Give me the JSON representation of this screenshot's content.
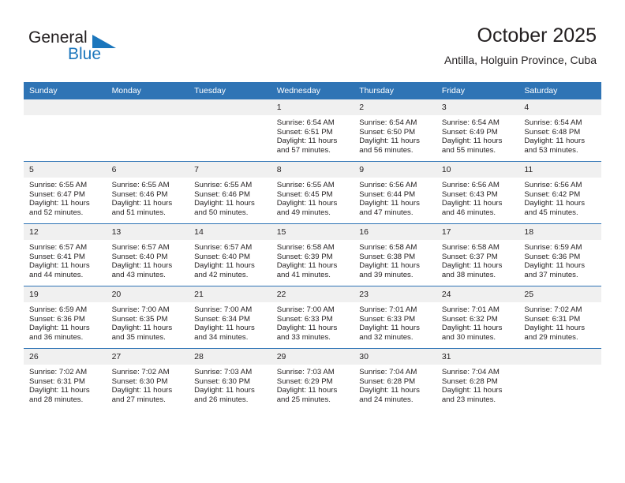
{
  "brand": {
    "word1": "General",
    "word2": "Blue",
    "triangle_color": "#1b76bc"
  },
  "header": {
    "title": "October 2025",
    "subtitle": "Antilla, Holguin Province, Cuba"
  },
  "theme": {
    "header_band": "#2f74b5",
    "daynum_band": "#f0f0f0",
    "text": "#231f20"
  },
  "labels": {
    "sunrise_prefix": "Sunrise:",
    "sunset_prefix": "Sunset:",
    "daylight_prefix": "Daylight:"
  },
  "weekdays": [
    "Sunday",
    "Monday",
    "Tuesday",
    "Wednesday",
    "Thursday",
    "Friday",
    "Saturday"
  ],
  "weeks": [
    [
      {
        "day": "",
        "sunrise": "",
        "sunset": "",
        "daylight_line1": "",
        "daylight_line2": "",
        "blank": true
      },
      {
        "day": "",
        "sunrise": "",
        "sunset": "",
        "daylight_line1": "",
        "daylight_line2": "",
        "blank": true
      },
      {
        "day": "",
        "sunrise": "",
        "sunset": "",
        "daylight_line1": "",
        "daylight_line2": "",
        "blank": true
      },
      {
        "day": "1",
        "sunrise": "Sunrise: 6:54 AM",
        "sunset": "Sunset: 6:51 PM",
        "daylight_line1": "Daylight: 11 hours",
        "daylight_line2": "and 57 minutes."
      },
      {
        "day": "2",
        "sunrise": "Sunrise: 6:54 AM",
        "sunset": "Sunset: 6:50 PM",
        "daylight_line1": "Daylight: 11 hours",
        "daylight_line2": "and 56 minutes."
      },
      {
        "day": "3",
        "sunrise": "Sunrise: 6:54 AM",
        "sunset": "Sunset: 6:49 PM",
        "daylight_line1": "Daylight: 11 hours",
        "daylight_line2": "and 55 minutes."
      },
      {
        "day": "4",
        "sunrise": "Sunrise: 6:54 AM",
        "sunset": "Sunset: 6:48 PM",
        "daylight_line1": "Daylight: 11 hours",
        "daylight_line2": "and 53 minutes."
      }
    ],
    [
      {
        "day": "5",
        "sunrise": "Sunrise: 6:55 AM",
        "sunset": "Sunset: 6:47 PM",
        "daylight_line1": "Daylight: 11 hours",
        "daylight_line2": "and 52 minutes."
      },
      {
        "day": "6",
        "sunrise": "Sunrise: 6:55 AM",
        "sunset": "Sunset: 6:46 PM",
        "daylight_line1": "Daylight: 11 hours",
        "daylight_line2": "and 51 minutes."
      },
      {
        "day": "7",
        "sunrise": "Sunrise: 6:55 AM",
        "sunset": "Sunset: 6:46 PM",
        "daylight_line1": "Daylight: 11 hours",
        "daylight_line2": "and 50 minutes."
      },
      {
        "day": "8",
        "sunrise": "Sunrise: 6:55 AM",
        "sunset": "Sunset: 6:45 PM",
        "daylight_line1": "Daylight: 11 hours",
        "daylight_line2": "and 49 minutes."
      },
      {
        "day": "9",
        "sunrise": "Sunrise: 6:56 AM",
        "sunset": "Sunset: 6:44 PM",
        "daylight_line1": "Daylight: 11 hours",
        "daylight_line2": "and 47 minutes."
      },
      {
        "day": "10",
        "sunrise": "Sunrise: 6:56 AM",
        "sunset": "Sunset: 6:43 PM",
        "daylight_line1": "Daylight: 11 hours",
        "daylight_line2": "and 46 minutes."
      },
      {
        "day": "11",
        "sunrise": "Sunrise: 6:56 AM",
        "sunset": "Sunset: 6:42 PM",
        "daylight_line1": "Daylight: 11 hours",
        "daylight_line2": "and 45 minutes."
      }
    ],
    [
      {
        "day": "12",
        "sunrise": "Sunrise: 6:57 AM",
        "sunset": "Sunset: 6:41 PM",
        "daylight_line1": "Daylight: 11 hours",
        "daylight_line2": "and 44 minutes."
      },
      {
        "day": "13",
        "sunrise": "Sunrise: 6:57 AM",
        "sunset": "Sunset: 6:40 PM",
        "daylight_line1": "Daylight: 11 hours",
        "daylight_line2": "and 43 minutes."
      },
      {
        "day": "14",
        "sunrise": "Sunrise: 6:57 AM",
        "sunset": "Sunset: 6:40 PM",
        "daylight_line1": "Daylight: 11 hours",
        "daylight_line2": "and 42 minutes."
      },
      {
        "day": "15",
        "sunrise": "Sunrise: 6:58 AM",
        "sunset": "Sunset: 6:39 PM",
        "daylight_line1": "Daylight: 11 hours",
        "daylight_line2": "and 41 minutes."
      },
      {
        "day": "16",
        "sunrise": "Sunrise: 6:58 AM",
        "sunset": "Sunset: 6:38 PM",
        "daylight_line1": "Daylight: 11 hours",
        "daylight_line2": "and 39 minutes."
      },
      {
        "day": "17",
        "sunrise": "Sunrise: 6:58 AM",
        "sunset": "Sunset: 6:37 PM",
        "daylight_line1": "Daylight: 11 hours",
        "daylight_line2": "and 38 minutes."
      },
      {
        "day": "18",
        "sunrise": "Sunrise: 6:59 AM",
        "sunset": "Sunset: 6:36 PM",
        "daylight_line1": "Daylight: 11 hours",
        "daylight_line2": "and 37 minutes."
      }
    ],
    [
      {
        "day": "19",
        "sunrise": "Sunrise: 6:59 AM",
        "sunset": "Sunset: 6:36 PM",
        "daylight_line1": "Daylight: 11 hours",
        "daylight_line2": "and 36 minutes."
      },
      {
        "day": "20",
        "sunrise": "Sunrise: 7:00 AM",
        "sunset": "Sunset: 6:35 PM",
        "daylight_line1": "Daylight: 11 hours",
        "daylight_line2": "and 35 minutes."
      },
      {
        "day": "21",
        "sunrise": "Sunrise: 7:00 AM",
        "sunset": "Sunset: 6:34 PM",
        "daylight_line1": "Daylight: 11 hours",
        "daylight_line2": "and 34 minutes."
      },
      {
        "day": "22",
        "sunrise": "Sunrise: 7:00 AM",
        "sunset": "Sunset: 6:33 PM",
        "daylight_line1": "Daylight: 11 hours",
        "daylight_line2": "and 33 minutes."
      },
      {
        "day": "23",
        "sunrise": "Sunrise: 7:01 AM",
        "sunset": "Sunset: 6:33 PM",
        "daylight_line1": "Daylight: 11 hours",
        "daylight_line2": "and 32 minutes."
      },
      {
        "day": "24",
        "sunrise": "Sunrise: 7:01 AM",
        "sunset": "Sunset: 6:32 PM",
        "daylight_line1": "Daylight: 11 hours",
        "daylight_line2": "and 30 minutes."
      },
      {
        "day": "25",
        "sunrise": "Sunrise: 7:02 AM",
        "sunset": "Sunset: 6:31 PM",
        "daylight_line1": "Daylight: 11 hours",
        "daylight_line2": "and 29 minutes."
      }
    ],
    [
      {
        "day": "26",
        "sunrise": "Sunrise: 7:02 AM",
        "sunset": "Sunset: 6:31 PM",
        "daylight_line1": "Daylight: 11 hours",
        "daylight_line2": "and 28 minutes."
      },
      {
        "day": "27",
        "sunrise": "Sunrise: 7:02 AM",
        "sunset": "Sunset: 6:30 PM",
        "daylight_line1": "Daylight: 11 hours",
        "daylight_line2": "and 27 minutes."
      },
      {
        "day": "28",
        "sunrise": "Sunrise: 7:03 AM",
        "sunset": "Sunset: 6:30 PM",
        "daylight_line1": "Daylight: 11 hours",
        "daylight_line2": "and 26 minutes."
      },
      {
        "day": "29",
        "sunrise": "Sunrise: 7:03 AM",
        "sunset": "Sunset: 6:29 PM",
        "daylight_line1": "Daylight: 11 hours",
        "daylight_line2": "and 25 minutes."
      },
      {
        "day": "30",
        "sunrise": "Sunrise: 7:04 AM",
        "sunset": "Sunset: 6:28 PM",
        "daylight_line1": "Daylight: 11 hours",
        "daylight_line2": "and 24 minutes."
      },
      {
        "day": "31",
        "sunrise": "Sunrise: 7:04 AM",
        "sunset": "Sunset: 6:28 PM",
        "daylight_line1": "Daylight: 11 hours",
        "daylight_line2": "and 23 minutes."
      },
      {
        "day": "",
        "sunrise": "",
        "sunset": "",
        "daylight_line1": "",
        "daylight_line2": "",
        "blank": true
      }
    ]
  ]
}
